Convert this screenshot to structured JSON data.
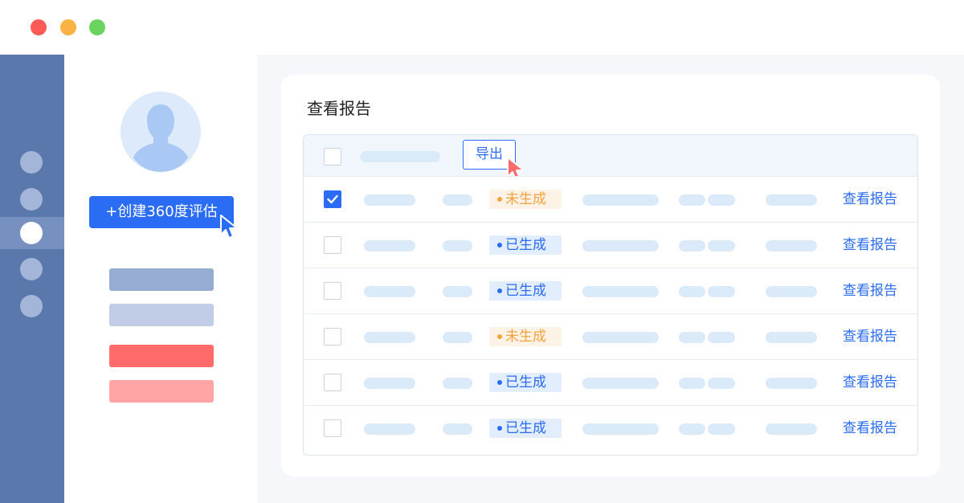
{
  "window": {
    "controls": [
      "close",
      "minimize",
      "maximize"
    ]
  },
  "sidebar": {
    "items": [
      {
        "icon": "nav-dot",
        "active": false
      },
      {
        "icon": "nav-dot",
        "active": false
      },
      {
        "icon": "nav-dot",
        "active": true
      },
      {
        "icon": "nav-dot",
        "active": false
      },
      {
        "icon": "nav-dot",
        "active": false
      }
    ]
  },
  "profile": {
    "avatar_icon": "user-silhouette-icon",
    "create_button_label": "+创建360度评估"
  },
  "report": {
    "title": "查看报告",
    "export_label": "导出",
    "rows": [
      {
        "checked": true,
        "status": "未生成",
        "status_type": "pending",
        "action": "查看报告"
      },
      {
        "checked": false,
        "status": "已生成",
        "status_type": "done",
        "action": "查看报告"
      },
      {
        "checked": false,
        "status": "已生成",
        "status_type": "done",
        "action": "查看报告"
      },
      {
        "checked": false,
        "status": "未生成",
        "status_type": "pending",
        "action": "查看报告"
      },
      {
        "checked": false,
        "status": "已生成",
        "status_type": "done",
        "action": "查看报告"
      },
      {
        "checked": false,
        "status": "已生成",
        "status_type": "done",
        "action": "查看报告"
      }
    ]
  },
  "colors": {
    "accent": "#2b6cf5",
    "sidebar": "#5b78ad",
    "pending": "#f7a23c",
    "danger": "#ff6a6a"
  }
}
